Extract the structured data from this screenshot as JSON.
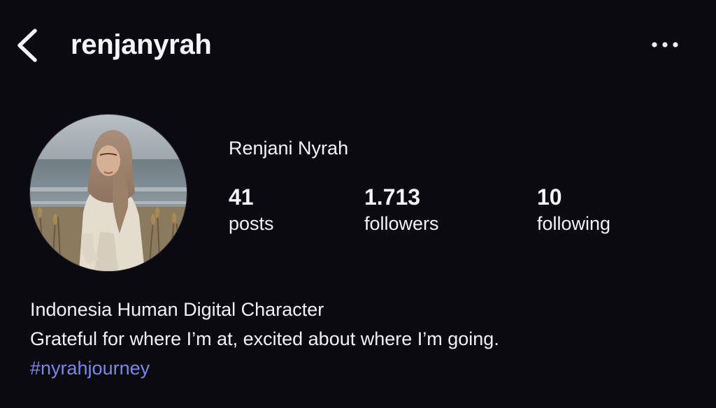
{
  "header": {
    "username": "renjanyrah",
    "back_icon": "chevron-left-icon",
    "more_icon": "more-horizontal-icon"
  },
  "profile": {
    "display_name": "Renjani Nyrah",
    "stats": {
      "posts": {
        "count": "41",
        "label": "posts"
      },
      "followers": {
        "count": "1.713",
        "label": "followers"
      },
      "following": {
        "count": "10",
        "label": "following"
      }
    }
  },
  "bio": {
    "line1": "Indonesia Human Digital Character",
    "line2": "Grateful for where I’m at, excited about where I’m going.",
    "hashtag": "#nyrahjourney"
  },
  "colors": {
    "background": "#0b0a11",
    "text": "#f4f4f6",
    "hashtag": "#7b86e8"
  }
}
